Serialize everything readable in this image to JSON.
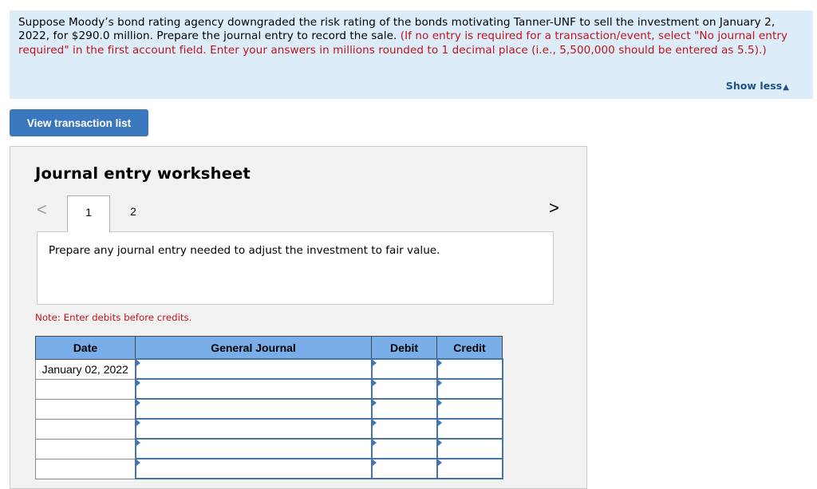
{
  "prompt": {
    "text_black": "Suppose Moody’s bond rating agency downgraded the risk rating of the bonds motivating Tanner-UNF to sell the investment on January 2, 2022, for $290.0 million. Prepare the journal entry to record the sale. ",
    "text_red": "(If no entry is required for a transaction/event, select \"No journal entry required\" in the first account field. Enter your answers in millions rounded to 1 decimal place (i.e., 5,500,000 should be entered as 5.5).)",
    "show_less_label": "Show less",
    "show_less_icon": "triangle-up"
  },
  "buttons": {
    "view_transaction_list": "View transaction list"
  },
  "worksheet": {
    "title": "Journal entry worksheet",
    "prev_icon": "chevron-left",
    "next_icon": "chevron-right",
    "tabs": [
      {
        "label": "1",
        "active": true
      },
      {
        "label": "2",
        "active": false
      }
    ],
    "instruction": "Prepare any journal entry needed to adjust the investment to fair value.",
    "note": "Note: Enter debits before credits.",
    "table": {
      "headers": [
        "Date",
        "General Journal",
        "Debit",
        "Credit"
      ],
      "rows": [
        {
          "date": "January 02, 2022",
          "account": "",
          "debit": "",
          "credit": ""
        },
        {
          "date": "",
          "account": "",
          "debit": "",
          "credit": ""
        },
        {
          "date": "",
          "account": "",
          "debit": "",
          "credit": ""
        },
        {
          "date": "",
          "account": "",
          "debit": "",
          "credit": ""
        },
        {
          "date": "",
          "account": "",
          "debit": "",
          "credit": ""
        },
        {
          "date": "",
          "account": "",
          "debit": "",
          "credit": ""
        }
      ]
    }
  }
}
